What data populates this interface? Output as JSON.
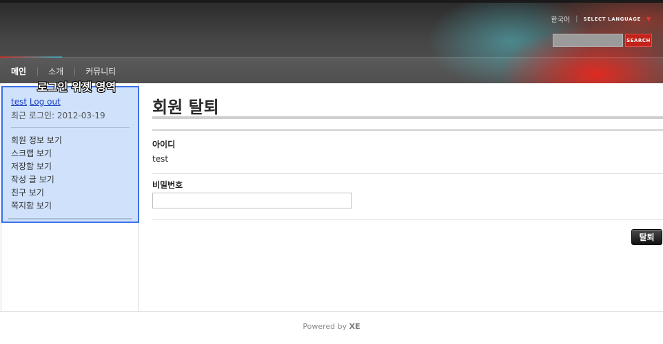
{
  "header": {
    "language_current": "한국어",
    "language_select": "SELECT LANGUAGE",
    "search_button": "SEARCH",
    "search_value": ""
  },
  "nav": {
    "items": [
      {
        "label": "메인"
      },
      {
        "label": "소개"
      },
      {
        "label": "커뮤니티"
      }
    ]
  },
  "annotation": {
    "widget_label": "로그인 위젯 영역"
  },
  "login_widget": {
    "user_id": "test",
    "logout": "Log out",
    "last_login": "최근 로그인: 2012-03-19",
    "links": [
      {
        "label": "회원 정보 보기"
      },
      {
        "label": "스크랩 보기"
      },
      {
        "label": "저장함 보기"
      },
      {
        "label": "작성 글 보기"
      },
      {
        "label": "친구 보기"
      },
      {
        "label": "쪽지함 보기"
      }
    ]
  },
  "main": {
    "title": "회원 탈퇴",
    "id_label": "아이디",
    "id_value": "test",
    "password_label": "비밀번호",
    "password_value": "",
    "submit_label": "탈퇴"
  },
  "footer": {
    "powered_by": "Powered by",
    "brand": "XE"
  },
  "colors": {
    "accent_red": "#c2231b",
    "widget_border": "#3b72e8",
    "widget_bg": "#cfe1fb",
    "link_blue": "#1a3fc2"
  }
}
